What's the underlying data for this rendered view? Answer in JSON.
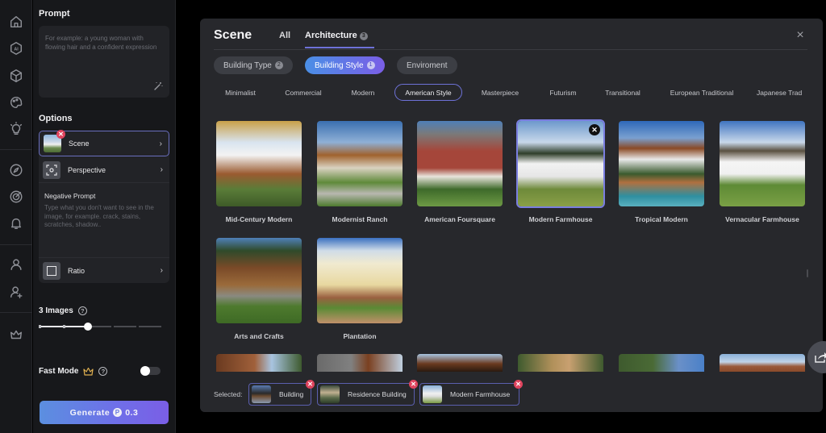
{
  "rail": {
    "icons": [
      "home-icon",
      "ai-icon",
      "cube-icon",
      "palette-icon",
      "lightbulb-icon",
      "compass-icon",
      "target-icon",
      "bell-icon",
      "user-icon",
      "user-add-icon",
      "crown-icon"
    ]
  },
  "panel": {
    "prompt_title": "Prompt",
    "prompt_placeholder": "For example: a young woman with flowing hair and a confident expression",
    "options_title": "Options",
    "options": [
      {
        "label": "Scene",
        "icon": "scene-thumbnail"
      },
      {
        "label": "Perspective",
        "icon": "perspective-icon"
      },
      {
        "label": "Ratio",
        "icon": "ratio-icon"
      }
    ],
    "negative_prompt_title": "Negative Prompt",
    "negative_prompt_placeholder": "Type what you don't want to see in the image, for example. crack, stains, scratches, shadow..",
    "images_label": "3 Images",
    "images_value": 3,
    "images_steps": 6,
    "fast_mode_label": "Fast Mode",
    "fast_mode_enabled": false,
    "help_glyph": "?",
    "generate_label": "Generate",
    "generate_cost": "0.3",
    "coin_glyph": "P"
  },
  "modal": {
    "title": "Scene",
    "tabs": [
      {
        "label": "All",
        "active": false
      },
      {
        "label": "Architecture",
        "count": "3",
        "active": true
      }
    ],
    "close_glyph": "×",
    "categories": [
      {
        "label": "Building Type",
        "count": "2",
        "active": false
      },
      {
        "label": "Building Style",
        "count": "1",
        "active": true
      },
      {
        "label": "Enviroment",
        "active": false
      }
    ],
    "styles": [
      "Minimalist",
      "Commercial",
      "Modern",
      "American Style",
      "Masterpiece",
      "Futurism",
      "Transitional",
      "European Traditional",
      "Japanese Trad"
    ],
    "active_style": "American Style",
    "cards": [
      {
        "label": "Mid-Century Modern",
        "selected": false
      },
      {
        "label": "Modernist Ranch",
        "selected": false
      },
      {
        "label": "American Foursquare",
        "selected": false
      },
      {
        "label": "Modern Farmhouse",
        "selected": true
      },
      {
        "label": "Tropical Modern",
        "selected": false
      },
      {
        "label": "Vernacular Farmhouse",
        "selected": false
      },
      {
        "label": "Arts and Crafts",
        "selected": false
      },
      {
        "label": "Plantation",
        "selected": false
      }
    ],
    "remove_glyph": "✕",
    "selected_label": "Selected:",
    "selected": [
      {
        "label": "Building"
      },
      {
        "label": "Residence Building"
      },
      {
        "label": "Modern Farmhouse"
      }
    ]
  },
  "colors": {
    "accent": "#6e72d8",
    "remove_badge": "#e0445e",
    "gradient_start": "#4a8fe6",
    "gradient_end": "#7a5ee6",
    "crown": "#e0b050"
  }
}
